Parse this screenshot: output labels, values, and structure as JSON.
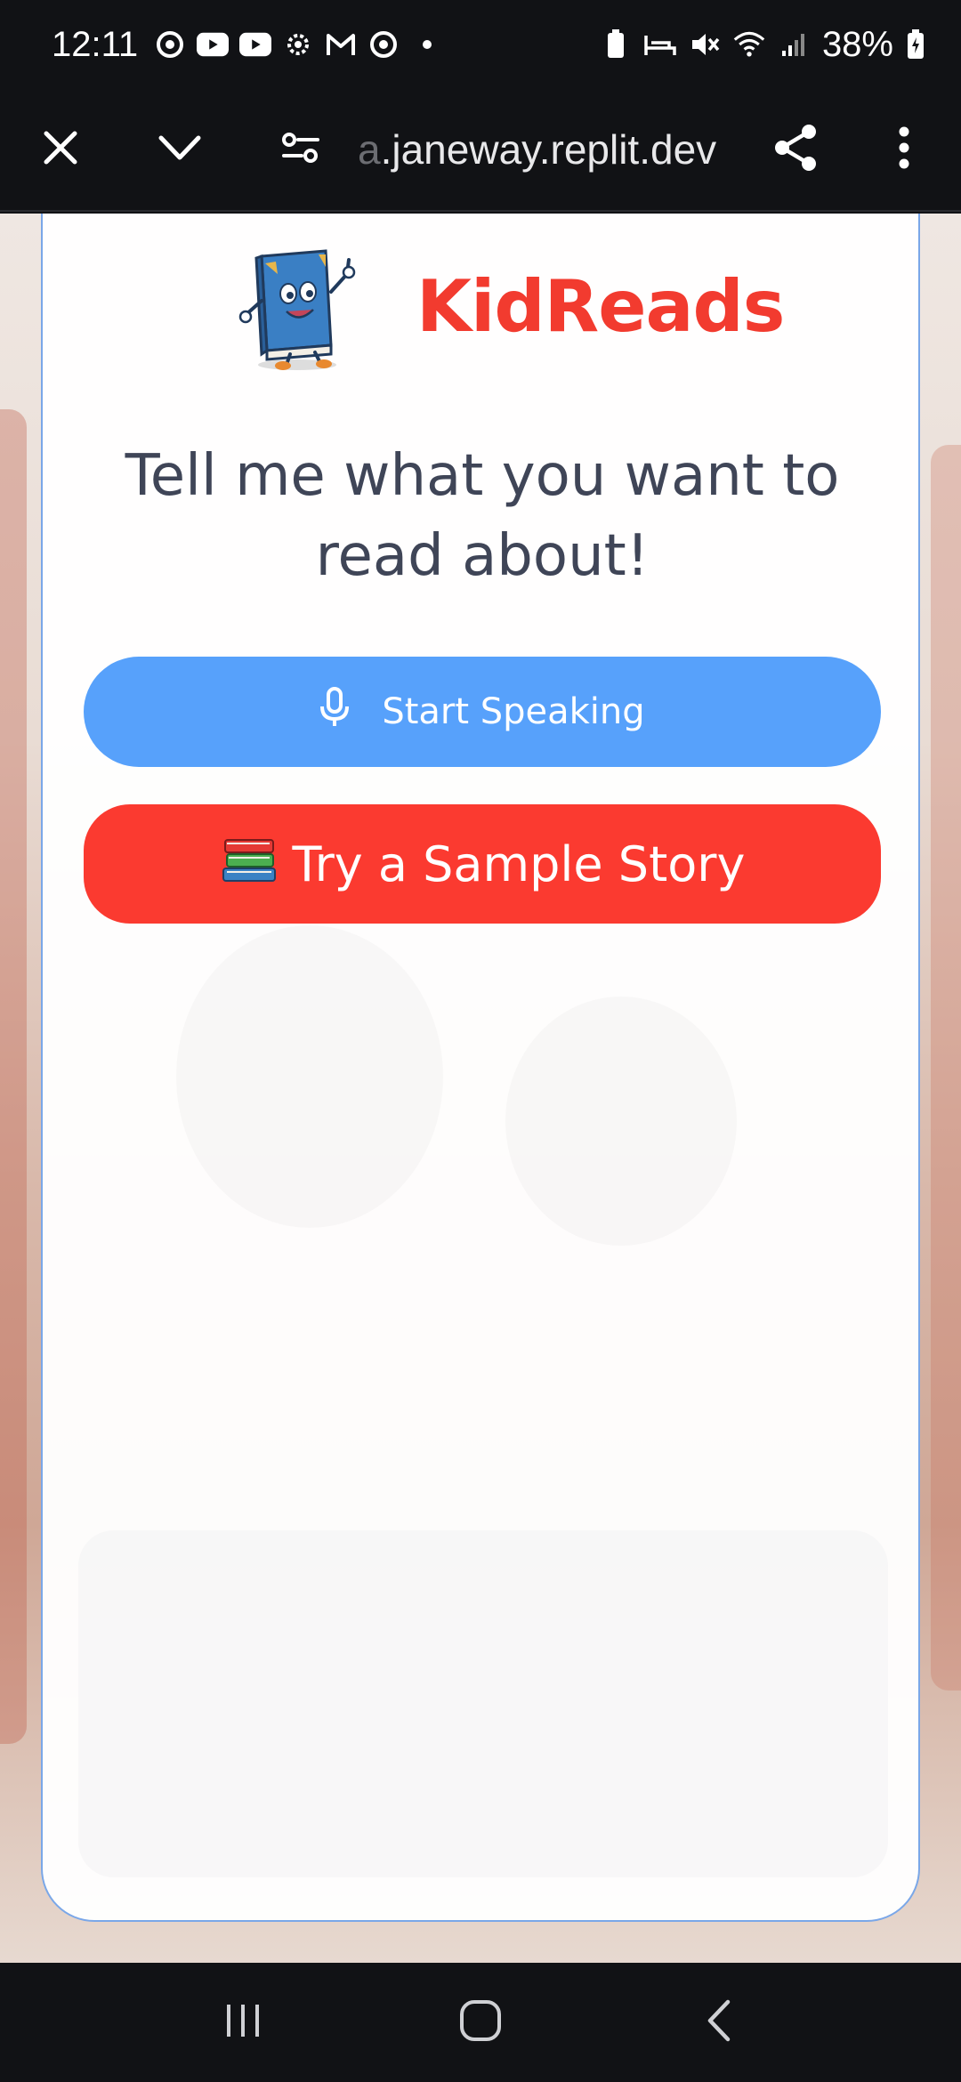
{
  "status_bar": {
    "time": "12:11",
    "battery": "38%",
    "left_icons": [
      "chrome-icon",
      "youtube-icon",
      "youtube-icon",
      "settings-gear-icon",
      "gmail-icon",
      "chrome-icon"
    ],
    "right_icons": [
      "battery-saver-icon",
      "sleep-icon",
      "mute-icon",
      "wifi-icon",
      "signal-icon",
      "battery-icon"
    ]
  },
  "browser": {
    "url_faded": "a",
    "url": ".janeway.replit.dev",
    "icons": [
      "close-icon",
      "chevron-down-icon",
      "site-settings-icon",
      "share-icon",
      "more-vert-icon"
    ]
  },
  "app": {
    "brand": "KidReads",
    "headline": "Tell me what you want to read about!",
    "speak_button": "Start Speaking",
    "sample_button": "Try a Sample Story",
    "sample_emoji": "📚",
    "colors": {
      "brand": "#f23b2f",
      "speak_button": "#57a1fb",
      "sample_button": "#fb3a30",
      "headline": "#3f4557"
    }
  },
  "nav": {
    "icons": [
      "recent-apps-icon",
      "home-icon",
      "back-icon"
    ]
  }
}
